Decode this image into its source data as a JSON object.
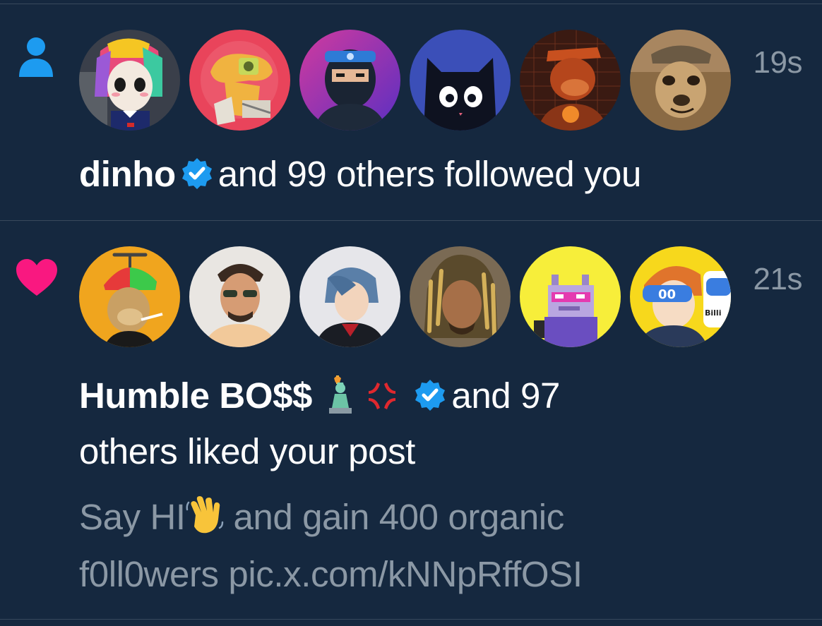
{
  "notifications": [
    {
      "type_icon": "person-icon",
      "time": "19s",
      "actor": "dinho",
      "actor_verified": true,
      "action_text": "and 99 others followed you",
      "avatars": [
        "avatar-colorful-girl",
        "avatar-dino-robot",
        "avatar-ninja",
        "avatar-black-cat",
        "avatar-salary-ape",
        "avatar-meerkat"
      ]
    },
    {
      "type_icon": "heart-icon",
      "time": "21s",
      "actor": "Humble BO$$",
      "actor_emojis": [
        "statue-of-liberty-icon",
        "anger-symbol-icon"
      ],
      "actor_verified": true,
      "action_text_line1": "and 97",
      "action_text_line2": "others liked your post",
      "post_preview_line1_a": "Say HI",
      "post_preview_emoji": "waving-hand-icon",
      "post_preview_line1_b": "and gain 400 organic",
      "post_preview_line2": "f0ll0wers pic.x.com/kNNpRffOSI",
      "avatars": [
        "avatar-propeller-ape",
        "avatar-man-sunglasses",
        "avatar-anime-boy",
        "avatar-dreadlocks-man",
        "avatar-pixel-cat",
        "avatar-anime-visor"
      ]
    }
  ],
  "colors": {
    "background": "#15283f",
    "accent_blue": "#1d9bf0",
    "like_pink": "#f91880",
    "muted_text": "#8b98a5",
    "divider": "#38495c"
  }
}
